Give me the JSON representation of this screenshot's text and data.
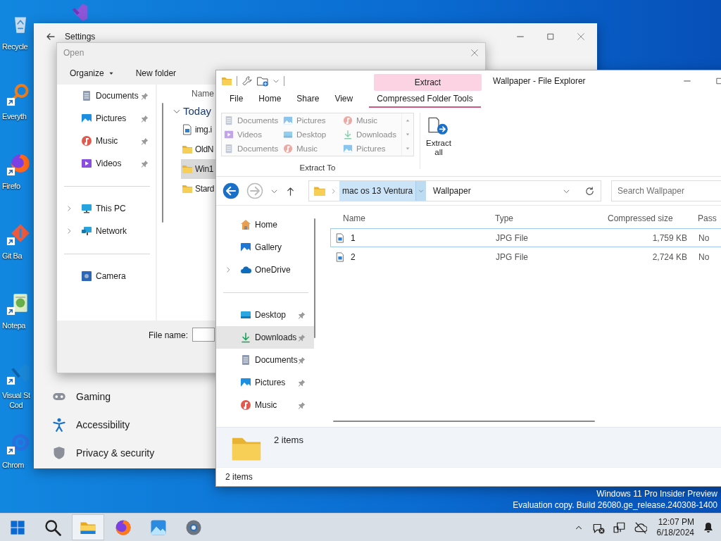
{
  "desktop_icons": [
    {
      "kind": "recycle",
      "label": "Recycle",
      "shortcut": false
    },
    {
      "kind": "finder",
      "label": "Everyth",
      "shortcut": true
    },
    {
      "kind": "fox",
      "label": "Firefo",
      "shortcut": true
    },
    {
      "kind": "git",
      "label": "Git Ba",
      "shortcut": true
    },
    {
      "kind": "notepad",
      "label": "Notepa",
      "shortcut": true
    },
    {
      "kind": "code",
      "label": "Visual St\nCod",
      "shortcut": true
    },
    {
      "kind": "chrome",
      "label": "Chrom",
      "shortcut": true
    }
  ],
  "desktop_notice": [
    "Windows 11 Pro Insider Preview",
    "Evaluation copy. Build 26080.ge_release.240308-1400"
  ],
  "settings": {
    "title": "Settings",
    "nav": [
      {
        "kind": "gaming",
        "label": "Gaming"
      },
      {
        "kind": "accessibility",
        "label": "Accessibility"
      },
      {
        "kind": "privacy",
        "label": "Privacy & security"
      }
    ]
  },
  "open_dialog": {
    "title": "Open",
    "organize": "Organize",
    "new_folder": "New folder",
    "nav_groups": [
      [
        {
          "kind": "documents",
          "label": "Documents",
          "pinned": true,
          "expandable": false,
          "selected": false
        },
        {
          "kind": "pictures",
          "label": "Pictures",
          "pinned": true,
          "expandable": false,
          "selected": false
        },
        {
          "kind": "music",
          "label": "Music",
          "pinned": true,
          "expandable": false,
          "selected": false
        },
        {
          "kind": "videos",
          "label": "Videos",
          "pinned": true,
          "expandable": false,
          "selected": false
        }
      ],
      [
        {
          "kind": "pc",
          "label": "This PC",
          "pinned": false,
          "expandable": true,
          "selected": false
        },
        {
          "kind": "network",
          "label": "Network",
          "pinned": false,
          "expandable": true,
          "selected": false
        }
      ],
      [
        {
          "kind": "camera",
          "label": "Camera",
          "pinned": false,
          "expandable": false,
          "selected": false
        }
      ]
    ],
    "column": "Name",
    "group": "Today",
    "files": [
      {
        "kind": "image",
        "name": "img.i",
        "selected": false
      },
      {
        "kind": "folder",
        "name": "OldN",
        "selected": false
      },
      {
        "kind": "folder",
        "name": "Win1",
        "selected": true
      },
      {
        "kind": "folder",
        "name": "Stard",
        "selected": false
      }
    ],
    "file_name_label": "File name:"
  },
  "explorer": {
    "title": "Wallpaper - File Explorer",
    "context_tab": "Extract",
    "tabs": [
      {
        "label": "File",
        "selected": false
      },
      {
        "label": "Home",
        "selected": false
      },
      {
        "label": "Share",
        "selected": false
      },
      {
        "label": "View",
        "selected": false
      },
      {
        "label": "Compressed Folder Tools",
        "selected": true
      }
    ],
    "extract_to": {
      "label": "Extract To",
      "items": [
        {
          "kind": "documents",
          "label": "Documents"
        },
        {
          "kind": "pictures",
          "label": "Pictures"
        },
        {
          "kind": "music",
          "label": "Music"
        },
        {
          "kind": "videos",
          "label": "Videos"
        },
        {
          "kind": "desktop",
          "label": "Desktop"
        },
        {
          "kind": "downloads",
          "label": "Downloads"
        },
        {
          "kind": "documents",
          "label": "Documents"
        },
        {
          "kind": "music",
          "label": "Music"
        },
        {
          "kind": "pictures",
          "label": "Pictures"
        }
      ]
    },
    "extract_all": "Extract all",
    "breadcrumb": [
      {
        "label": "mac os 13 Ventura",
        "highlighted": true
      },
      {
        "label": "Wallpaper",
        "highlighted": false
      }
    ],
    "search": {
      "placeholder": "Search Wallpaper"
    },
    "nav_groups": [
      [
        {
          "kind": "home",
          "label": "Home",
          "pinned": false,
          "expandable": false,
          "selected": false
        },
        {
          "kind": "gallery",
          "label": "Gallery",
          "pinned": false,
          "expandable": false,
          "selected": false
        },
        {
          "kind": "onedrive",
          "label": "OneDrive",
          "pinned": false,
          "expandable": true,
          "selected": false
        }
      ],
      [
        {
          "kind": "desktop",
          "label": "Desktop",
          "pinned": true,
          "expandable": false,
          "selected": false
        },
        {
          "kind": "downloads",
          "label": "Downloads",
          "pinned": true,
          "expandable": false,
          "selected": true
        },
        {
          "kind": "documents",
          "label": "Documents",
          "pinned": true,
          "expandable": false,
          "selected": false
        },
        {
          "kind": "pictures",
          "label": "Pictures",
          "pinned": true,
          "expandable": false,
          "selected": false
        },
        {
          "kind": "music",
          "label": "Music",
          "pinned": true,
          "expandable": false,
          "selected": false
        }
      ]
    ],
    "columns": [
      "Name",
      "Type",
      "Compressed size",
      "Pass"
    ],
    "rows": [
      {
        "name": "1",
        "type": "JPG File",
        "size": "1,759 KB",
        "password": "No",
        "focused": true
      },
      {
        "name": "2",
        "type": "JPG File",
        "size": "2,724 KB",
        "password": "No",
        "focused": false
      }
    ],
    "details": "2 items",
    "status": "2 items"
  },
  "taskbar": {
    "apps": [
      {
        "kind": "start",
        "selected": false
      },
      {
        "kind": "search",
        "selected": false
      },
      {
        "kind": "explorer",
        "selected": true
      },
      {
        "kind": "fox",
        "selected": false
      },
      {
        "kind": "photos",
        "selected": false
      },
      {
        "kind": "settings",
        "selected": false
      }
    ],
    "time": "12:07 PM",
    "date": "6/18/2024"
  }
}
